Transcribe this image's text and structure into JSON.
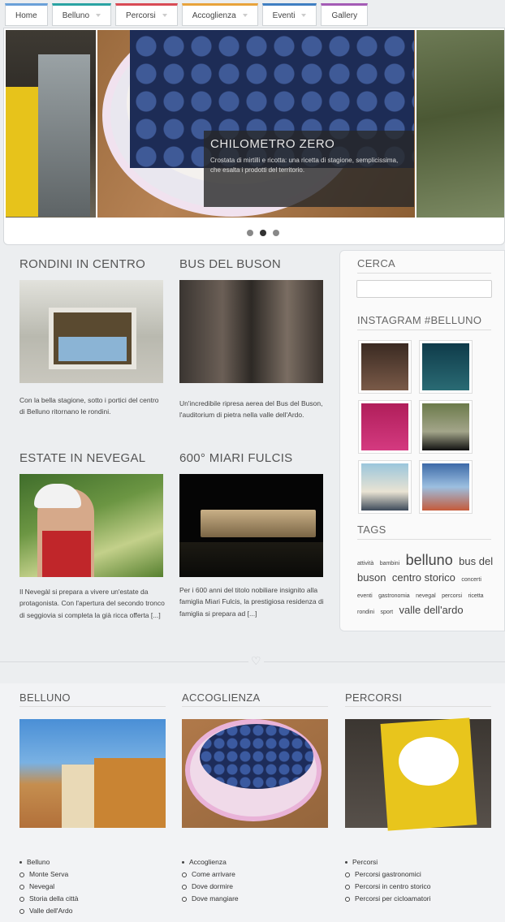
{
  "nav": {
    "items": [
      {
        "label": "Home",
        "color": "#6aa0d8",
        "dropdown": false
      },
      {
        "label": "Belluno",
        "color": "#2aa3a3",
        "dropdown": true
      },
      {
        "label": "Percorsi",
        "color": "#d84b55",
        "dropdown": true
      },
      {
        "label": "Accoglienza",
        "color": "#e8a33c",
        "dropdown": true
      },
      {
        "label": "Eventi",
        "color": "#3f7fc2",
        "dropdown": true
      },
      {
        "label": "Gallery",
        "color": "#a45bb5",
        "dropdown": false
      }
    ]
  },
  "slider": {
    "caption_title": "CHILOMETRO ZERO",
    "caption_text": "Crostata di mirtilli e ricotta: una ricetta di stagione, semplicissima, che esalta i prodotti del territorio.",
    "dots": 3,
    "active_dot": 2
  },
  "posts": [
    {
      "title": "RONDINI IN CENTRO",
      "excerpt": "Con la bella stagione, sotto i portici del centro di Belluno ritornano le rondini."
    },
    {
      "title": "BUS DEL BUSON",
      "excerpt": "Un'incredibile ripresa aerea del Bus del Buson, l'auditorium di pietra nella valle dell'Ardo."
    },
    {
      "title": "ESTATE IN NEVEGAL",
      "excerpt": "Il Nevegàl si prepara a vivere un'estate da protagonista. Con l'apertura del secondo tronco di seggiovia si completa la già ricca offerta [...]"
    },
    {
      "title": "600° MIARI FULCIS",
      "excerpt": "Per i 600 anni del titolo nobiliare insignito alla famiglia Miari Fulcis, la prestigiosa residenza di famiglia si prepara ad [...]"
    }
  ],
  "sidebar": {
    "search_title": "CERCA",
    "instagram_title": "INSTAGRAM #BELLUNO",
    "tags_title": "TAGS",
    "tags": [
      {
        "label": "attività",
        "size": 7
      },
      {
        "label": "bambini",
        "size": 7
      },
      {
        "label": "belluno",
        "size": 18
      },
      {
        "label": "bus del",
        "size": 14
      },
      {
        "label": "buson",
        "size": 14
      },
      {
        "label": "centro storico",
        "size": 14
      },
      {
        "label": "concerti",
        "size": 7
      },
      {
        "label": "eventi",
        "size": 7
      },
      {
        "label": "gastronomia",
        "size": 7
      },
      {
        "label": "nevegal",
        "size": 7
      },
      {
        "label": "percorsi",
        "size": 7
      },
      {
        "label": "ricetta",
        "size": 7
      },
      {
        "label": "rondini",
        "size": 7
      },
      {
        "label": "sport",
        "size": 7
      },
      {
        "label": "valle dell'ardo",
        "size": 14
      }
    ]
  },
  "bottom": {
    "columns": [
      {
        "title": "BELLUNO",
        "links": [
          "Belluno",
          "Monte Serva",
          "Nevegal",
          "Storia della città",
          "Valle dell'Ardo"
        ]
      },
      {
        "title": "ACCOGLIENZA",
        "links": [
          "Accoglienza",
          "Come arrivare",
          "Dove dormire",
          "Dove mangiare"
        ]
      },
      {
        "title": "PERCORSI",
        "links": [
          "Percorsi",
          "Percorsi gastronomici",
          "Percorsi in centro storico",
          "Percorsi per cicloamatori"
        ]
      }
    ]
  }
}
